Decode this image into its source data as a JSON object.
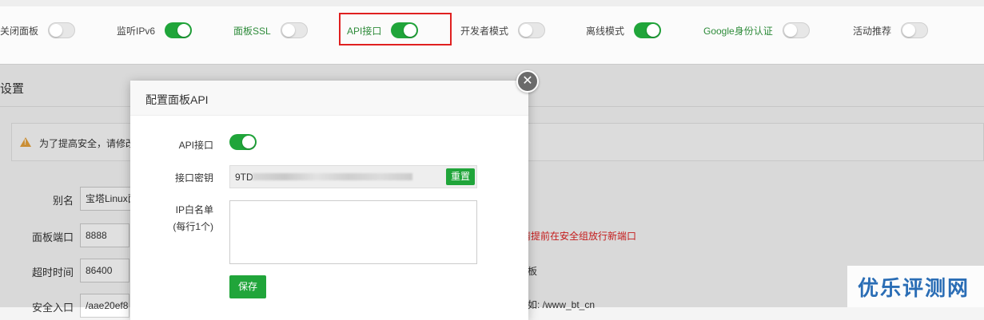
{
  "toggles": [
    {
      "label": "关闭面板",
      "on": false,
      "green": false
    },
    {
      "label": "监听IPv6",
      "on": true,
      "green": false
    },
    {
      "label": "面板SSL",
      "on": false,
      "green": true
    },
    {
      "label": "API接口",
      "on": true,
      "green": true
    },
    {
      "label": "开发者模式",
      "on": false,
      "green": false
    },
    {
      "label": "离线模式",
      "on": true,
      "green": false
    },
    {
      "label": "Google身份认证",
      "on": false,
      "green": true
    },
    {
      "label": "活动推荐",
      "on": false,
      "green": false
    }
  ],
  "settings": {
    "title": "设置",
    "alert_text": "为了提高安全，请修改",
    "rows": [
      {
        "label": "别名",
        "value": "宝塔Linux面板"
      },
      {
        "label": "面板端口",
        "value": "8888"
      },
      {
        "label": "超时时间",
        "value": "86400"
      },
      {
        "label": "安全入口",
        "value": "/aae20ef8"
      }
    ],
    "port_note": "器请提前在安全组放行新端口",
    "timeout_note": "板",
    "entry_note": "如: /www_bt_cn"
  },
  "dialog": {
    "title": "配置面板API",
    "api_label": "API接口",
    "api_enabled": true,
    "key_label": "接口密钥",
    "key_value": "9TD",
    "reset_label": "重置",
    "ip_label_1": "IP白名单",
    "ip_label_2": "(每行1个)",
    "ip_value": "",
    "save_label": "保存",
    "close_symbol": "✕"
  },
  "watermark": "优乐评测网",
  "colors": {
    "accent": "#20a53a",
    "highlight": "#e02020"
  }
}
